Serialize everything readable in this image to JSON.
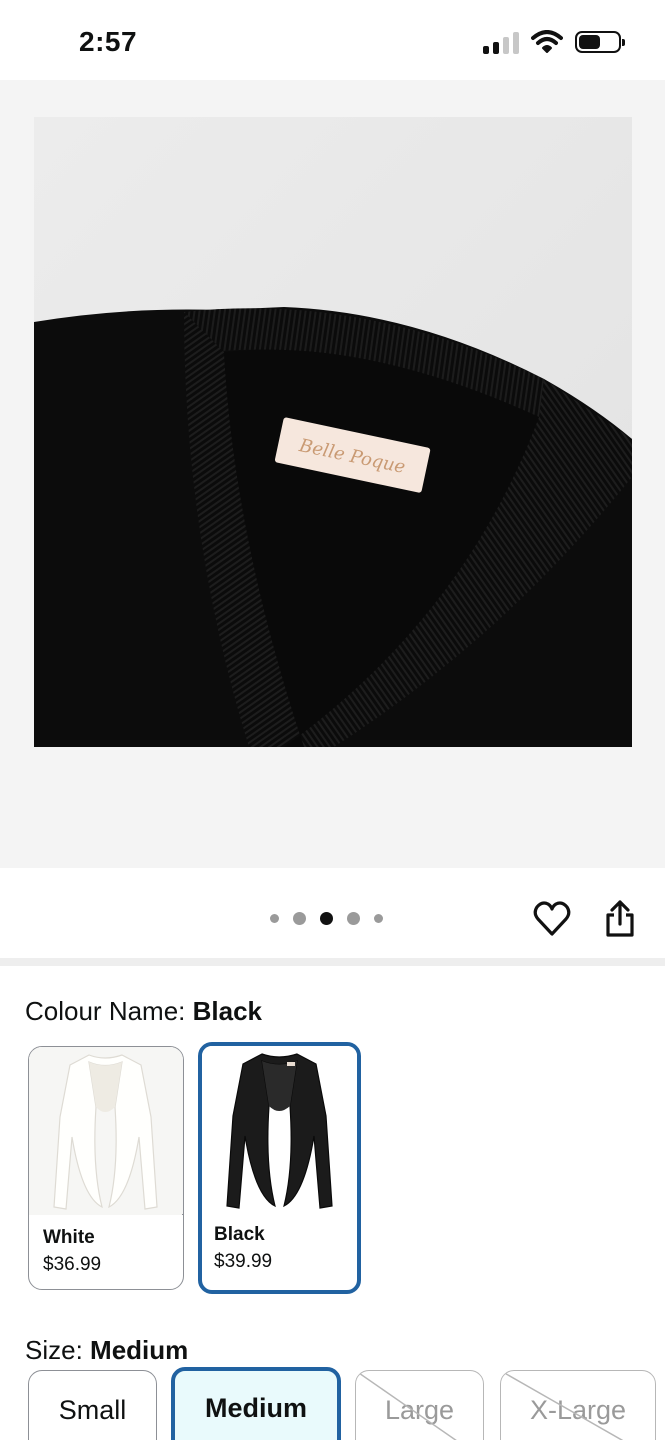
{
  "status_bar": {
    "time": "2:57"
  },
  "gallery": {
    "image_label": "Belle Poque",
    "dot_count": 5,
    "active_dot": 3
  },
  "colour": {
    "label": "Colour Name: ",
    "selected": "Black",
    "options": [
      {
        "name": "White",
        "price": "$36.99",
        "selected": false
      },
      {
        "name": "Black",
        "price": "$39.99",
        "selected": true
      }
    ]
  },
  "size": {
    "label": "Size: ",
    "selected": "Medium",
    "options": [
      {
        "label": "Small",
        "available": true,
        "selected": false
      },
      {
        "label": "Medium",
        "available": true,
        "selected": true
      },
      {
        "label": "Large",
        "available": false,
        "selected": false
      },
      {
        "label": "X-Large",
        "available": false,
        "selected": false
      }
    ]
  },
  "colors": {
    "accent": "#2162a1",
    "selected_bg": "#e9fafc"
  },
  "icons": [
    "signal-icon",
    "wifi-icon",
    "battery-icon",
    "heart-icon",
    "share-icon"
  ]
}
